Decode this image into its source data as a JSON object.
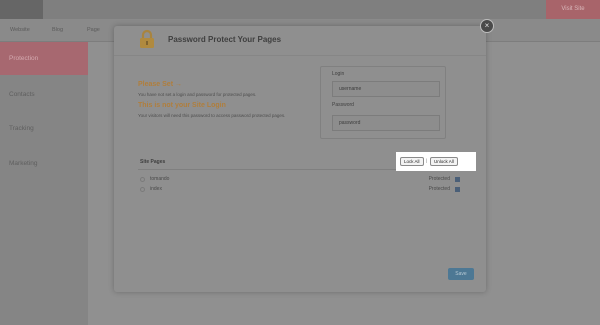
{
  "app": {
    "visit_label": "Visit Site"
  },
  "subnav": {
    "items": [
      "Website",
      "Blog",
      "Page"
    ]
  },
  "sidebar": {
    "items": [
      {
        "label": "Protection",
        "active": true
      },
      {
        "label": "Contacts",
        "active": false
      },
      {
        "label": "Tracking",
        "active": false
      },
      {
        "label": "Marketing",
        "active": false
      }
    ]
  },
  "modal": {
    "title": "Password Protect Your Pages",
    "close_icon": "×",
    "please_set_title": "Please Set →",
    "please_set_desc": "You have not set a login and password for protected pages.",
    "not_site_login_title": "This is not your Site Login",
    "not_site_login_desc": "Your visitors will need this password to access password protected pages.",
    "login_label": "Login",
    "login_value": "username",
    "password_label": "Password",
    "password_value": "password",
    "site_pages_label": "Site Pages",
    "lock_all_label": "Lock All",
    "unlock_all_label": "Unlock All",
    "pages": [
      {
        "name": "tomando",
        "status": "Protected"
      },
      {
        "name": "index",
        "status": "Protected"
      }
    ],
    "save_label": "Save"
  },
  "colors": {
    "accent_orange": "#b07e3c",
    "sidebar_active": "#a76870",
    "save_button": "#4d7894",
    "overlay_gray": "#8c8c8c"
  },
  "icons": {
    "header_icon": "lock-icon",
    "close_icon": "close-icon",
    "row_icon": "lock-toggle-icon"
  }
}
